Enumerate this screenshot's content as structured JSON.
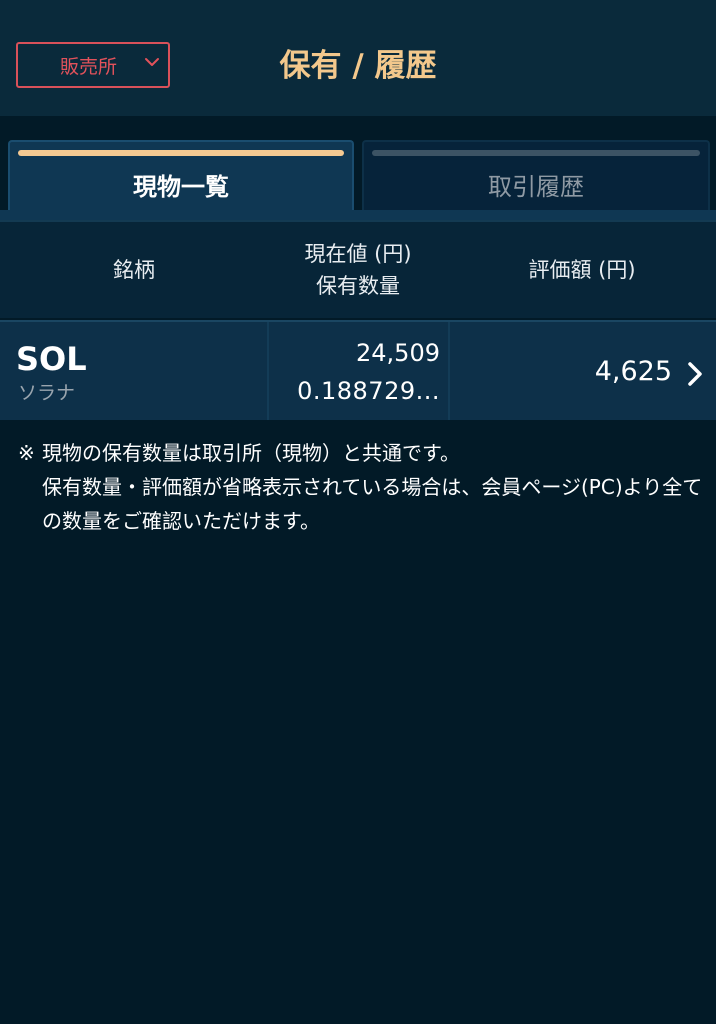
{
  "header": {
    "title": "保有 / 履歴",
    "market_select": {
      "selected": "販売所",
      "icon": "chevron-down-icon"
    }
  },
  "tabs": [
    {
      "label": "現物一覧",
      "active": true
    },
    {
      "label": "取引履歴",
      "active": false
    }
  ],
  "table": {
    "columns": {
      "name": "銘柄",
      "price": "現在値 (円)",
      "quantity": "保有数量",
      "value": "評価額 (円)"
    },
    "rows": [
      {
        "symbol": "SOL",
        "name": "ソラナ",
        "price": "24,509",
        "quantity": "0.188729...",
        "value": "4,625",
        "icon": "chevron-right-icon"
      }
    ]
  },
  "notes": {
    "mark": "※",
    "line1": "現物の保有数量は取引所（現物）と共通です。",
    "line2": "保有数量・評価額が省略表示されている場合は、会員ページ(PC)より全ての数量をご確認いただけます。"
  },
  "colors": {
    "background": "#021a27",
    "accent": "#f3c88c",
    "market_border": "#d9515a"
  }
}
